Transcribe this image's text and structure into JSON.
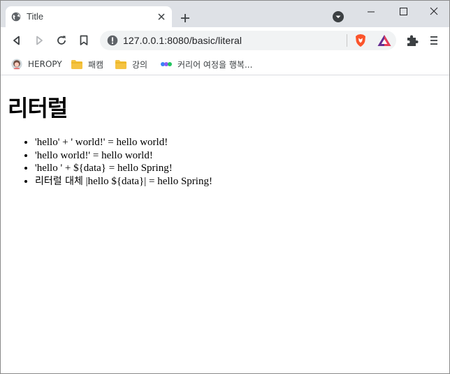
{
  "browser": {
    "tab": {
      "title": "Title"
    },
    "url": "127.0.0.1:8080/basic/literal",
    "bookmarks": [
      {
        "label": "HEROPY"
      },
      {
        "label": "패캠"
      },
      {
        "label": "강의"
      },
      {
        "label": "커리어 여정을 행복..."
      }
    ]
  },
  "page": {
    "heading": "리터럴",
    "items": [
      {
        "text": "'hello' + ' world!' = hello world!"
      },
      {
        "text": "'hello world!' = hello world!"
      },
      {
        "text": "'hello ' + ${data} = hello Spring!"
      },
      {
        "prefix": "리터럴 대체",
        "text": " |hello ${data}| = hello Spring!"
      }
    ]
  },
  "colors": {
    "tabstrip": "#dee1e6",
    "omnibox": "#f1f3f4",
    "brave_orange": "#fb542b",
    "bat_purple": "#662d91",
    "folder_yellow": "#f5c342"
  }
}
